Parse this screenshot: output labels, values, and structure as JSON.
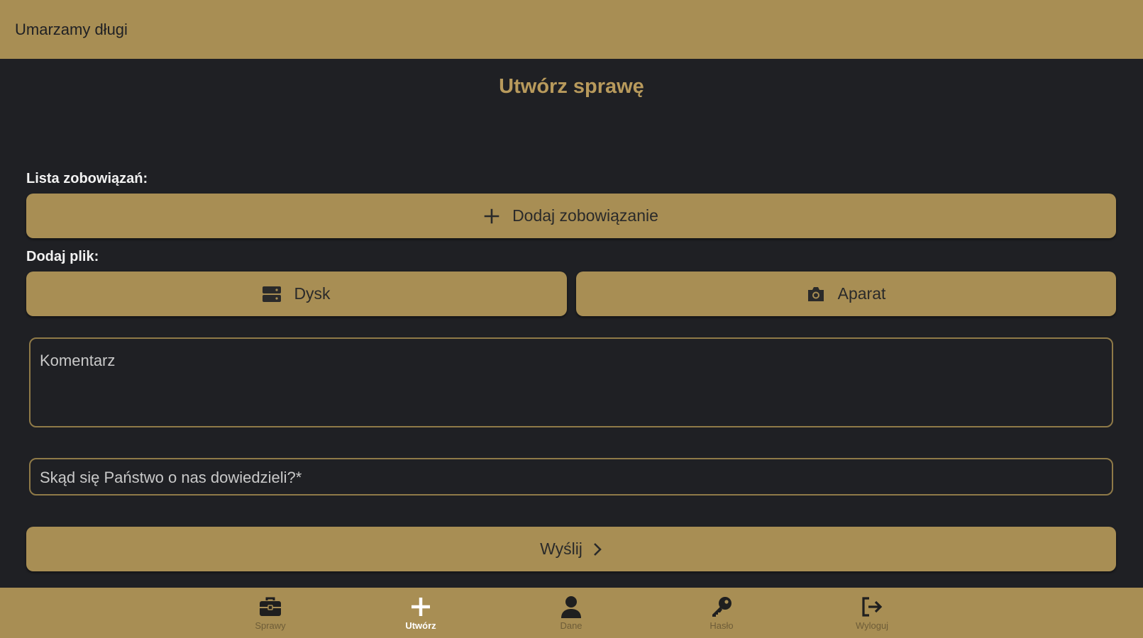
{
  "header": {
    "title": "Umarzamy długi"
  },
  "page": {
    "title": "Utwórz sprawę"
  },
  "obligations": {
    "label": "Lista zobowiązań:",
    "add_button": "Dodaj zobowiązanie",
    "add_icon": "plus-icon"
  },
  "files": {
    "label": "Dodaj plik:",
    "disk_button": "Dysk",
    "disk_icon": "drive-icon",
    "camera_button": "Aparat",
    "camera_icon": "camera-icon"
  },
  "comment": {
    "placeholder": "Komentarz"
  },
  "source": {
    "placeholder": "Skąd się Państwo o nas dowiedzieli?*"
  },
  "submit": {
    "label": "Wyślij",
    "icon": "chevron-right-icon"
  },
  "bottom_nav": [
    {
      "label": "Sprawy",
      "icon": "briefcase-icon",
      "active": false
    },
    {
      "label": "Utwórz",
      "icon": "plus-icon",
      "active": true
    },
    {
      "label": "Dane",
      "icon": "person-icon",
      "active": false
    },
    {
      "label": "Hasło",
      "icon": "key-icon",
      "active": false
    },
    {
      "label": "Wyloguj",
      "icon": "logout-icon",
      "active": false
    }
  ],
  "colors": {
    "brand_gold": "#a88e54",
    "background": "#1f2024",
    "title_gold": "#b89a5c"
  }
}
